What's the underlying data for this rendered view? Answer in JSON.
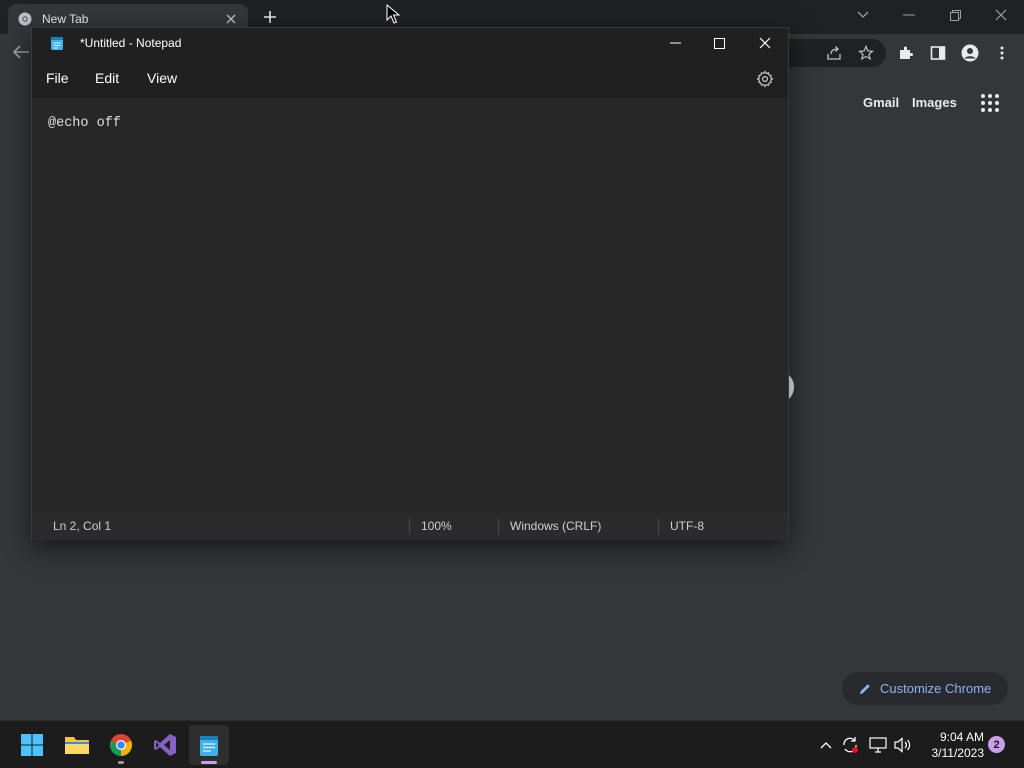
{
  "chrome": {
    "tab_title": "New Tab",
    "ntp_links": [
      "Gmail",
      "Images"
    ],
    "customize_label": "Customize Chrome"
  },
  "notepad": {
    "title": "*Untitled - Notepad",
    "menu": [
      "File",
      "Edit",
      "View"
    ],
    "content": "@echo off",
    "status": {
      "position": "Ln 2, Col 1",
      "zoom": "100%",
      "line_ending": "Windows (CRLF)",
      "encoding": "UTF-8"
    }
  },
  "taskbar": {
    "apps": [
      "start-icon",
      "file-explorer-icon",
      "chrome-icon",
      "visual-studio-icon",
      "notepad-icon"
    ],
    "time": "9:04 AM",
    "date": "3/11/2023",
    "notification_count": "2"
  },
  "colors": {
    "chrome_bg": "#35363a",
    "notepad_bg": "#272727",
    "accent_blue": "#8ab4f8",
    "taskbar_bg": "#1c1c1c"
  }
}
